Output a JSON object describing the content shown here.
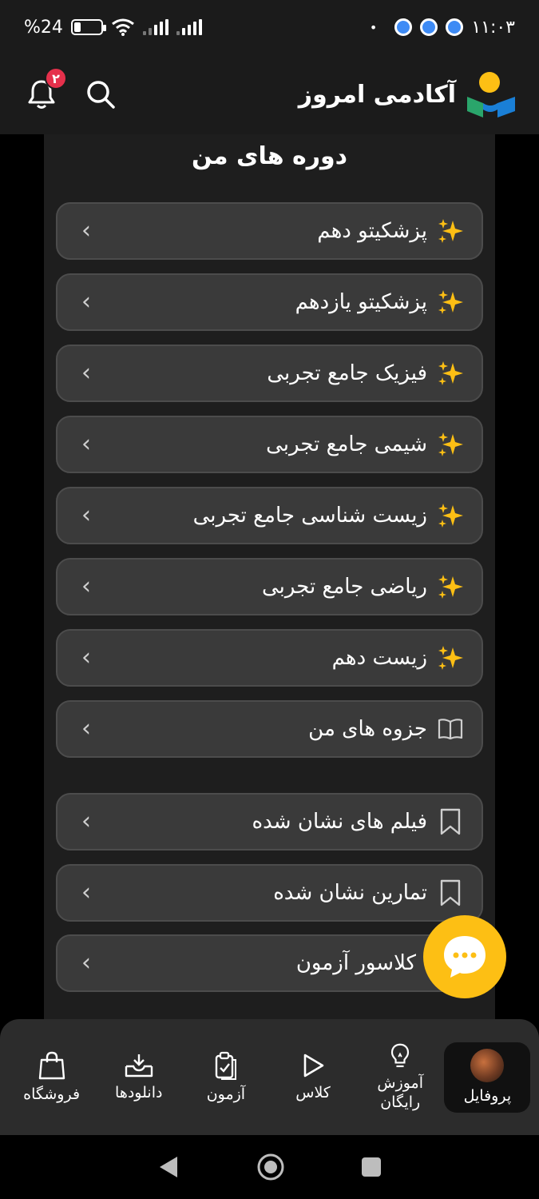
{
  "status_bar": {
    "time": "۱۱:۰۳",
    "battery_percent": "%24",
    "battery_level": 0.24,
    "dot": "•"
  },
  "header": {
    "brand": "آکادمی امروز",
    "notification_count": "۲"
  },
  "page_title": "دوره های من",
  "courses": [
    {
      "label": "پزشکیتو دهم",
      "icon": "sparkles-icon"
    },
    {
      "label": "پزشکیتو یازدهم",
      "icon": "sparkles-icon"
    },
    {
      "label": "فیزیک جامع تجربی",
      "icon": "sparkles-icon"
    },
    {
      "label": "شیمی جامع تجربی",
      "icon": "sparkles-icon"
    },
    {
      "label": "زیست شناسی جامع تجربی",
      "icon": "sparkles-icon"
    },
    {
      "label": "ریاضی جامع تجربی",
      "icon": "sparkles-icon"
    },
    {
      "label": "زیست دهم",
      "icon": "sparkles-icon"
    },
    {
      "label": "جزوه های من",
      "icon": "book-icon"
    }
  ],
  "saved": [
    {
      "label": "فیلم های نشان شده",
      "icon": "bookmark-icon"
    },
    {
      "label": "تمارین نشان شده",
      "icon": "bookmark-icon"
    },
    {
      "label": "کلاسور آزمون",
      "icon": "none"
    }
  ],
  "bottom_nav": [
    {
      "label": "پروفایل",
      "icon": "avatar",
      "active": true
    },
    {
      "label": "آموزش رایگان",
      "icon": "lightbulb-icon",
      "active": false
    },
    {
      "label": "کلاس",
      "icon": "play-icon",
      "active": false
    },
    {
      "label": "آزمون",
      "icon": "clipboard-check-icon",
      "active": false
    },
    {
      "label": "دانلودها",
      "icon": "download-tray-icon",
      "active": false
    },
    {
      "label": "فروشگاه",
      "icon": "shopping-bag-icon",
      "active": false
    }
  ],
  "colors": {
    "accent_yellow": "#fdbf14",
    "badge_red": "#e5304b",
    "brand_blue": "#1a7fd6",
    "brand_green": "#2aa56b"
  }
}
